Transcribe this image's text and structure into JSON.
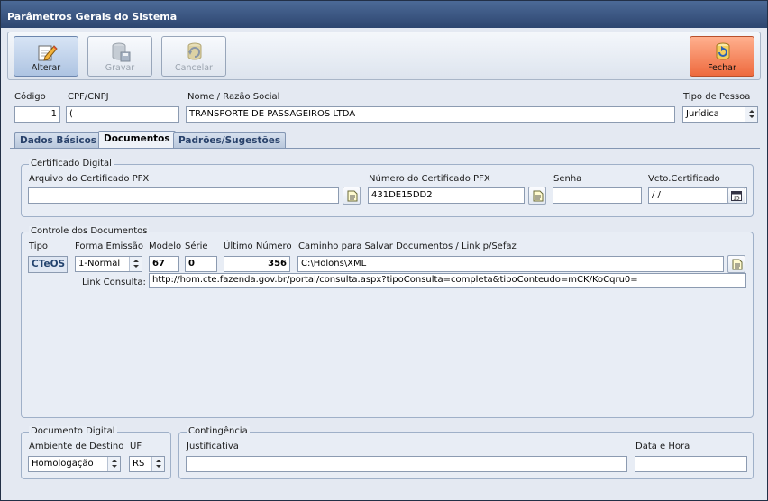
{
  "window": {
    "title": "Parâmetros Gerais do Sistema"
  },
  "toolbar": {
    "alterar": "Alterar",
    "gravar": "Gravar",
    "cancelar": "Cancelar",
    "fechar": "Fechar"
  },
  "header": {
    "codigo_label": "Código",
    "codigo_value": "1",
    "cpf_label": "CPF/CNPJ",
    "cpf_value": "(",
    "nome_label": "Nome / Razão Social",
    "nome_value": "TRANSPORTE DE PASSAGEIROS  LTDA",
    "tipo_pessoa_label": "Tipo de Pessoa",
    "tipo_pessoa_value": "Jurídica"
  },
  "tabs": [
    {
      "label": "Dados Básicos"
    },
    {
      "label": "Documentos"
    },
    {
      "label": "Padrões/Sugestões"
    }
  ],
  "certificado": {
    "title": "Certificado Digital",
    "arquivo_label": "Arquivo do Certificado PFX",
    "arquivo_value": "",
    "numero_label": "Número do Certificado PFX",
    "numero_value": "431DE15DD2",
    "senha_label": "Senha",
    "senha_value": "",
    "vcto_label": "Vcto.Certificado",
    "vcto_value": " /  /"
  },
  "controle": {
    "title": "Controle dos Documentos",
    "tipo_label": "Tipo",
    "tipo_value": "CTeOS",
    "forma_label": "Forma Emissão",
    "forma_value": "1-Normal",
    "modelo_label": "Modelo",
    "modelo_value": "67",
    "serie_label": "Série",
    "serie_value": "0",
    "ultimo_label": "Último Número",
    "ultimo_value": "356",
    "caminho_label": "Caminho para Salvar Documentos / Link p/Sefaz",
    "caminho_value": "C:\\Holons\\XML",
    "link_label": "Link Consulta:",
    "link_value": "http://hom.cte.fazenda.gov.br/portal/consulta.aspx?tipoConsulta=completa&tipoConteudo=mCK/KoCqru0="
  },
  "documento_digital": {
    "title": "Documento Digital",
    "ambiente_label": "Ambiente de Destino",
    "ambiente_value": "Homologação",
    "uf_label": "UF",
    "uf_value": "RS"
  },
  "contingencia": {
    "title": "Contingência",
    "justificativa_label": "Justificativa",
    "justificativa_value": "",
    "data_hora_label": "Data e Hora",
    "data_hora_value": ""
  },
  "colors": {
    "titlebar": "#3c5784",
    "fechar_button": "#f07a4c",
    "active_button": "#b9cde8"
  }
}
